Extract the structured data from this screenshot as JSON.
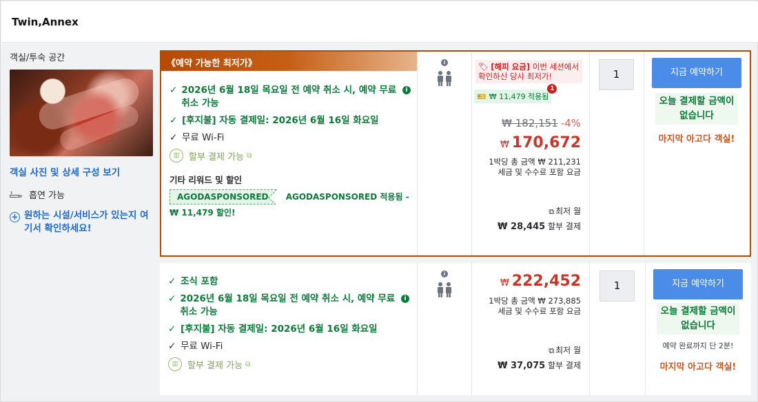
{
  "header": {
    "title": "Twin,Annex"
  },
  "left": {
    "section_label": "객실/투숙 공간",
    "photo_link": "객실 사진 및 상세 구성 보기",
    "smoking": "흡연 가능",
    "facility_link": "원하는 시설/서비스가 있는지 여기서 확인하세요!"
  },
  "offers": [
    {
      "banner": "《예약 가능한 최저가》",
      "features": [
        "2026년 6월 18일 목요일 전 예약 취소 시, 예약 무료 취소 가능",
        "[후지불] 자동 결제일: 2026년 6월 16일 화요일",
        "무료 Wi-Fi"
      ],
      "installment": "할부 결제 가능",
      "other_label": "기타 리워드 및 할인",
      "coupon_code": "AGODASPONSORED",
      "coupon_text": "AGODASPONSORED 적용됨 - ₩ 11,479 할인!",
      "hotdeal_tag": "[해피 요금]",
      "hotdeal_text": "이번 세션에서 확인하신 당사 최저가!",
      "coupon_badge": "₩ 11,479 적용됨",
      "coupon_badge_count": "1",
      "original_price": "₩ 182,151",
      "discount_pct": "-4%",
      "currency": "₩",
      "price": "170,672",
      "per_night_line1": "1박당 총 금액 ₩ 211,231",
      "per_night_line2": "세금 및 수수료 포함 요금",
      "monthly_label": "최저 월",
      "monthly_amount": "₩ 28,445",
      "monthly_suffix": "할부 결제",
      "quantity": "1",
      "book_label": "지금 예약하기",
      "no_pay": "오늘 결제할 금액이 없습니다",
      "last_room": "마지막 아고다 객실!"
    },
    {
      "features": [
        "조식 포함",
        "2026년 6월 18일 목요일 전 예약 취소 시, 예약 무료 취소 가능",
        "[후지불] 자동 결제일: 2026년 6월 16일 화요일",
        "무료 Wi-Fi"
      ],
      "installment": "할부 결제 가능",
      "currency": "₩",
      "price": "222,452",
      "per_night_line1": "1박당 총 금액 ₩ 273,885",
      "per_night_line2": "세금 및 수수료 포함 요금",
      "monthly_label": "최저 월",
      "monthly_amount": "₩ 37,075",
      "monthly_suffix": "할부 결제",
      "quantity": "1",
      "book_label": "지금 예약하기",
      "no_pay": "오늘 결제할 금액이 없습니다",
      "countdown": "예약 완료까지 단 2분!",
      "last_room": "마지막 아고다 객실!"
    }
  ],
  "colors": {
    "accent": "#4a8ce8",
    "banner": "#b64a05",
    "price": "#c8352b",
    "green": "#0b7a3b"
  }
}
